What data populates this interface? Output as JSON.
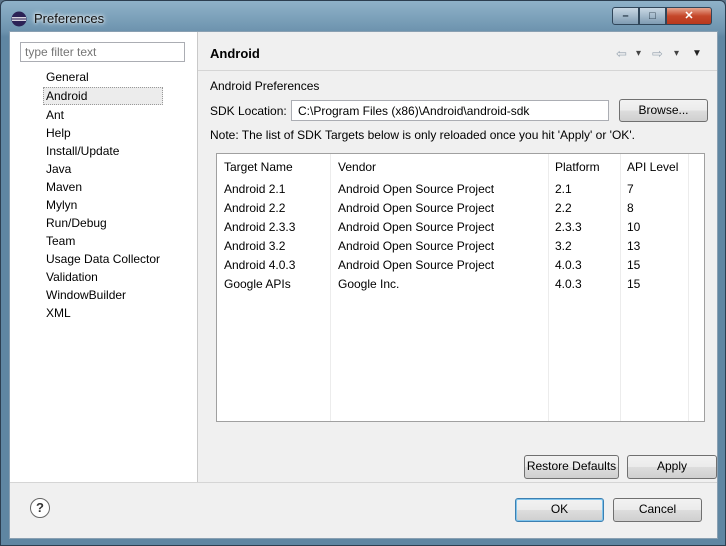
{
  "window": {
    "title": "Preferences",
    "icon": "eclipse-icon",
    "buttons": {
      "minimize": "–",
      "maximize": "□",
      "close": "✕"
    }
  },
  "filter": {
    "placeholder": "type filter text"
  },
  "tree": {
    "items": [
      "General",
      "Android",
      "Ant",
      "Help",
      "Install/Update",
      "Java",
      "Maven",
      "Mylyn",
      "Run/Debug",
      "Team",
      "Usage Data Collector",
      "Validation",
      "WindowBuilder",
      "XML"
    ],
    "selected": "Android"
  },
  "page": {
    "title": "Android",
    "nav": {
      "back": "⇦",
      "back_menu": "▾",
      "forward": "⇨",
      "forward_menu": "▾",
      "view_menu": "▼"
    },
    "section_label": "Android Preferences",
    "sdk_label": "SDK Location:",
    "sdk_value": "C:\\Program Files (x86)\\Android\\android-sdk",
    "browse_label": "Browse...",
    "note": "Note: The list of SDK Targets below is only reloaded once you hit 'Apply' or 'OK'.",
    "table": {
      "headers": [
        "Target Name",
        "Vendor",
        "Platform",
        "API Level"
      ],
      "rows": [
        [
          "Android 2.1",
          "Android Open Source Project",
          "2.1",
          "7"
        ],
        [
          "Android 2.2",
          "Android Open Source Project",
          "2.2",
          "8"
        ],
        [
          "Android 2.3.3",
          "Android Open Source Project",
          "2.3.3",
          "10"
        ],
        [
          "Android 3.2",
          "Android Open Source Project",
          "3.2",
          "13"
        ],
        [
          "Android 4.0.3",
          "Android Open Source Project",
          "4.0.3",
          "15"
        ],
        [
          "Google APIs",
          "Google Inc.",
          "4.0.3",
          "15"
        ]
      ]
    },
    "restore_label": "Restore Defaults",
    "apply_label": "Apply"
  },
  "footer": {
    "help": "?",
    "ok_label": "OK",
    "cancel_label": "Cancel"
  }
}
